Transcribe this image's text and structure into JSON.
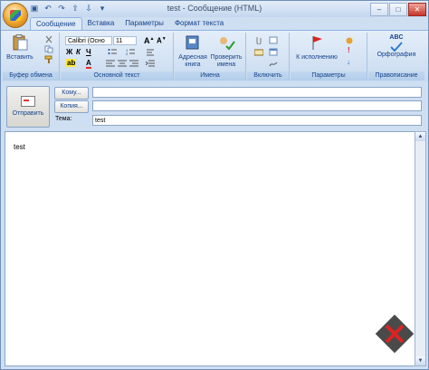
{
  "window": {
    "title": "test - Сообщение (HTML)",
    "controls": [
      "–",
      "□",
      "✕"
    ]
  },
  "qat": {
    "icons": [
      "save-icon",
      "undo-icon",
      "redo-icon",
      "up-icon",
      "down-icon",
      "customize-icon"
    ]
  },
  "tabs": [
    {
      "label": "Сообщение",
      "active": true
    },
    {
      "label": "Вставка",
      "active": false
    },
    {
      "label": "Параметры",
      "active": false
    },
    {
      "label": "Формат текста",
      "active": false
    }
  ],
  "ribbon": {
    "clipboard": {
      "label": "Буфер обмена",
      "paste": "Вставить"
    },
    "basic_text": {
      "label": "Основной текст",
      "font": "Calibri (Осно",
      "size": "11",
      "bold": "Ж",
      "italic": "К",
      "underline": "Ч"
    },
    "names": {
      "label": "Имена",
      "address_book": "Адресная книга",
      "check_names": "Проверить имена"
    },
    "include": {
      "label": "Включить"
    },
    "options": {
      "label": "Параметры",
      "follow_up": "К исполнению"
    },
    "proofing": {
      "label": "Правописание",
      "spelling": "Орфография",
      "abc": "ABC"
    }
  },
  "header": {
    "send_label": "Отправить",
    "to_button": "Кому...",
    "cc_button": "Копия...",
    "subject_label": "Тема:",
    "to_value": "",
    "cc_value": "",
    "subject_value": "test"
  },
  "body": {
    "text": "test"
  },
  "colors": {
    "accent": "#15428b",
    "ribbon_bg": "#dbe7f6"
  }
}
